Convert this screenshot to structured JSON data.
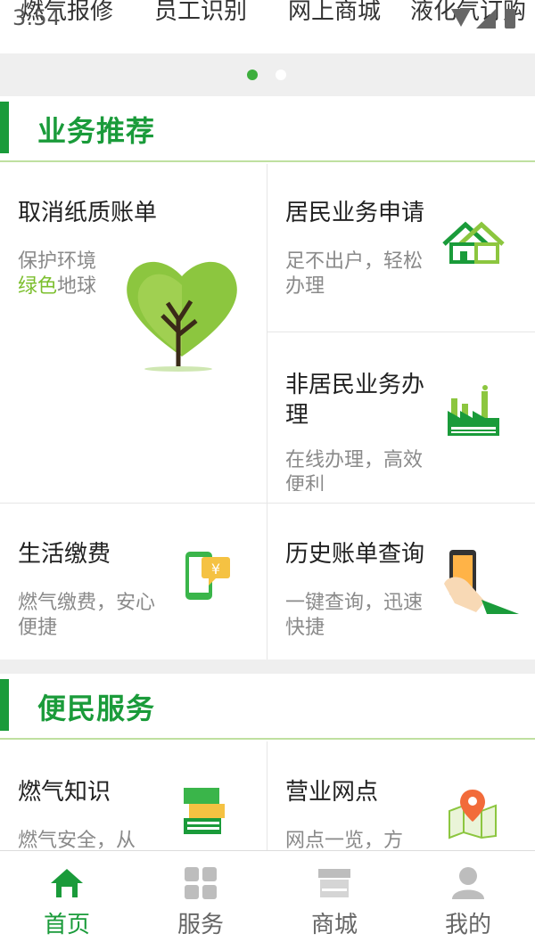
{
  "status_bar": {
    "time": "3:54"
  },
  "quick_links": [
    "燃气报修",
    "员工识别",
    "网上商城",
    "液化气订购"
  ],
  "sections": {
    "business": {
      "title": "业务推荐",
      "cards": {
        "paperless": {
          "title": "取消纸质账单",
          "sub_line1": "保护环境",
          "sub_green": "绿色",
          "sub_rest": "地球",
          "icon": "heart-tree-icon"
        },
        "resident": {
          "title": "居民业务申请",
          "sub": "足不出户，轻松办理",
          "icon": "house-icon"
        },
        "nonresident": {
          "title": "非居民业务办理",
          "sub": "在线办理，高效便利",
          "icon": "factory-icon"
        },
        "payment": {
          "title": "生活缴费",
          "sub": "燃气缴费，安心便捷",
          "icon": "phone-payment-icon"
        },
        "history": {
          "title": "历史账单查询",
          "sub": "一键查询，迅速快捷",
          "icon": "hand-phone-icon"
        }
      }
    },
    "service": {
      "title": "便民服务",
      "cards": {
        "knowledge": {
          "title": "燃气知识",
          "sub": "燃气安全，从",
          "icon": "books-icon"
        },
        "outlets": {
          "title": "营业网点",
          "sub": "网点一览，方",
          "icon": "map-pin-icon"
        }
      }
    }
  },
  "bottom_nav": [
    {
      "label": "首页",
      "icon": "home-icon",
      "active": true
    },
    {
      "label": "服务",
      "icon": "grid-icon",
      "active": false
    },
    {
      "label": "商城",
      "icon": "store-icon",
      "active": false
    },
    {
      "label": "我的",
      "icon": "user-icon",
      "active": false
    }
  ],
  "colors": {
    "primary_green": "#1a9b3a",
    "light_green": "#7cbf2e",
    "background_gray": "#efefef"
  }
}
